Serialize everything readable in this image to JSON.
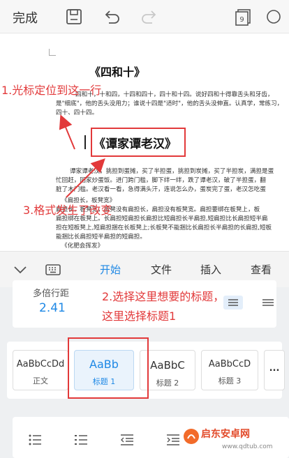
{
  "toolbar": {
    "done_label": "完成",
    "icons": [
      "save-icon",
      "undo-icon",
      "redo-icon",
      "page-count-icon"
    ],
    "page_count": "9"
  },
  "document": {
    "heading1": "《四和十》",
    "para1_lines": [
      "四和十，十和四，十四和四十，四十和十四。说好四和十得靠舌头和牙齿，",
      "是\"细底\"，他的舌头没用力；谁说十四是\"适时\"，他的舌头没伸直。认真学，常练习，",
      "四十、四十四。"
    ],
    "heading2": "《谭家谭老汉》",
    "para2_lines": [
      "谭家谭老汉，挑担到蛋摊，买了半担蛋，挑担到炭摊，买了半担炭，满担是蛋",
      "忙回赶，回家炒蛋饭。进门跨门槛，脚下绊一绊，跌了谭老汉，破了半担蛋，翻",
      "脏了木门槛。老汉看一看，急得满头汗，连说怎么办，蛋炭完了蛋，老汉怎吃蛋"
    ],
    "para3_lines": [
      "《扁担长，板凳宽》",
      "扁担长，板凳宽，板凳没有扁担长，扁担没有板凳宽。扁担要绑在板凳上，板",
      "扁担绑在板凳上。长扁担短扁担长扁担比短扁担长半扁担,短扁担比长扁担短半扁",
      "担在短板凳上,短扁担捆在长板凳上;长板凳不能捆比长扁担长半扁担的长扁担,短板",
      "能捆比长扁担短半扁担的短扁担。",
      "《化肥会挥发》"
    ]
  },
  "annotations": {
    "step1": "1.光标定位到这一行",
    "step2_line1": "2.选择这里想要的标题，",
    "step2_line2": "这里选择标题1",
    "step3": "3.格式发生了改变"
  },
  "tabs": {
    "items": [
      {
        "label": "开始",
        "active": true
      },
      {
        "label": "文件",
        "active": false
      },
      {
        "label": "插入",
        "active": false
      },
      {
        "label": "查看",
        "active": false
      }
    ]
  },
  "line_spacing": {
    "label": "多倍行距",
    "value": "2.41"
  },
  "styles": [
    {
      "sample": "AaBbCcDd",
      "name": "正文",
      "selected": false
    },
    {
      "sample": "AaBb",
      "name": "标题 1",
      "selected": true
    },
    {
      "sample": "AaBbC",
      "name": "标题 2",
      "selected": false
    },
    {
      "sample": "AaBbCcD",
      "name": "标题 3",
      "selected": false
    },
    {
      "sample": "...",
      "name": "",
      "selected": false
    }
  ],
  "watermark": {
    "text": "启东安卓网",
    "sub": "www.qdtub.com"
  },
  "colors": {
    "accent": "#1e88e5",
    "annotation": "#e2393a"
  }
}
